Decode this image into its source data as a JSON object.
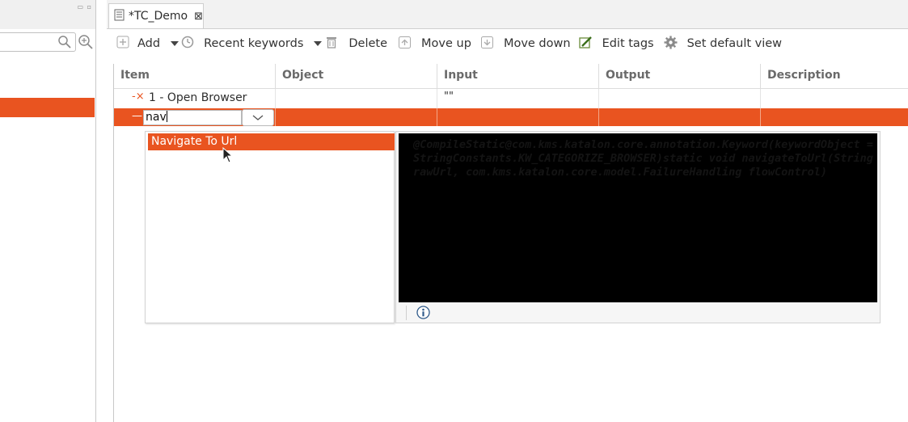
{
  "editor": {
    "tab_title": "*TC_Demo"
  },
  "toolbar": {
    "add_label": "Add",
    "recent_keywords_label": "Recent keywords",
    "delete_label": "Delete",
    "move_up_label": "Move up",
    "move_down_label": "Move down",
    "edit_tags_label": "Edit tags",
    "set_default_view_label": "Set default view"
  },
  "grid": {
    "columns": [
      "Item",
      "Object",
      "Input",
      "Output",
      "Description"
    ],
    "rows": [
      {
        "item": "1 - Open Browser",
        "object": "",
        "input": "\"\"",
        "output": "",
        "description": ""
      }
    ],
    "editing_value": "nav"
  },
  "autocomplete": {
    "suggestions": [
      "Navigate To Url"
    ],
    "doc_text": "@CompileStatic@com.kms.katalon.core.annotation.Keyword(keywordObject = StringConstants.KW_CATEGORIZE_BROWSER)static void navigateToUrl(String rawUrl, com.kms.katalon.core.model.FailureHandling flowControl)"
  },
  "colors": {
    "accent": "#e95420"
  }
}
